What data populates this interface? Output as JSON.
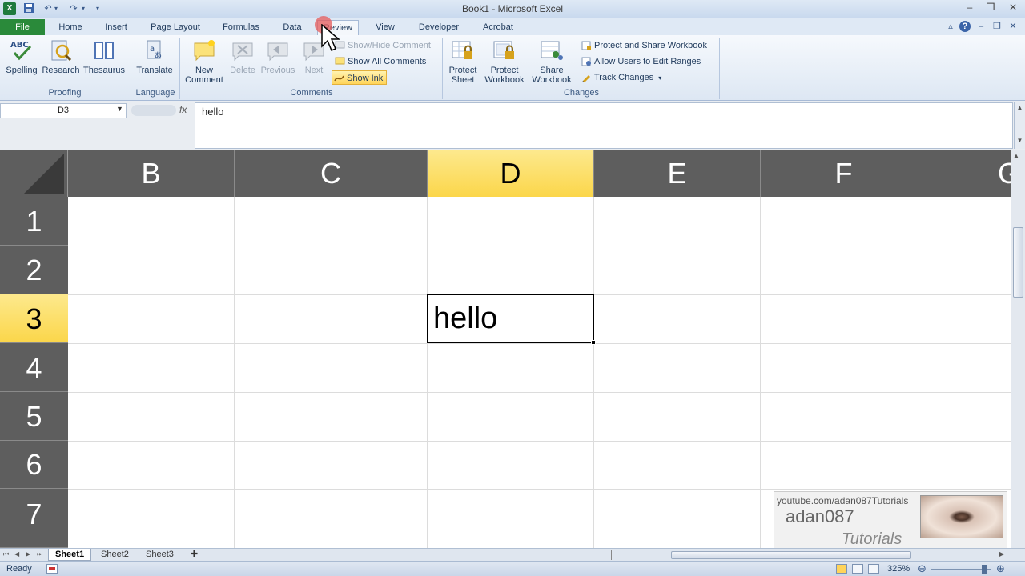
{
  "window": {
    "title": "Book1 - Microsoft Excel",
    "app_icon": "X"
  },
  "tabs": [
    "File",
    "Home",
    "Insert",
    "Page Layout",
    "Formulas",
    "Data",
    "Review",
    "View",
    "Developer",
    "Acrobat"
  ],
  "active_tab": "Review",
  "ribbon": {
    "proofing": {
      "label": "Proofing",
      "spelling": "Spelling",
      "research": "Research",
      "thesaurus": "Thesaurus"
    },
    "language": {
      "label": "Language",
      "translate": "Translate"
    },
    "comments": {
      "label": "Comments",
      "new_comment": "New\nComment",
      "delete": "Delete",
      "previous": "Previous",
      "next": "Next",
      "show_hide": "Show/Hide Comment",
      "show_all": "Show All Comments",
      "show_ink": "Show Ink"
    },
    "changes": {
      "label": "Changes",
      "protect_sheet": "Protect\nSheet",
      "protect_workbook": "Protect\nWorkbook",
      "share_workbook": "Share\nWorkbook",
      "protect_share": "Protect and Share Workbook",
      "allow_users": "Allow Users to Edit Ranges",
      "track_changes": "Track Changes"
    }
  },
  "formula_bar": {
    "name_box": "D3",
    "fx": "fx",
    "value": "hello"
  },
  "grid": {
    "columns": [
      "B",
      "C",
      "D",
      "E",
      "F",
      "G"
    ],
    "rows": [
      "1",
      "2",
      "3",
      "4",
      "5",
      "6",
      "7"
    ],
    "selected_column": "D",
    "selected_row": "3",
    "active_cell_value": "hello"
  },
  "sheets": [
    "Sheet1",
    "Sheet2",
    "Sheet3"
  ],
  "active_sheet": "Sheet1",
  "status": {
    "text": "Ready",
    "zoom": "325%"
  },
  "watermark": {
    "url": "youtube.com/adan087Tutorials",
    "name": "adan087",
    "subtitle": "Tutorials"
  }
}
